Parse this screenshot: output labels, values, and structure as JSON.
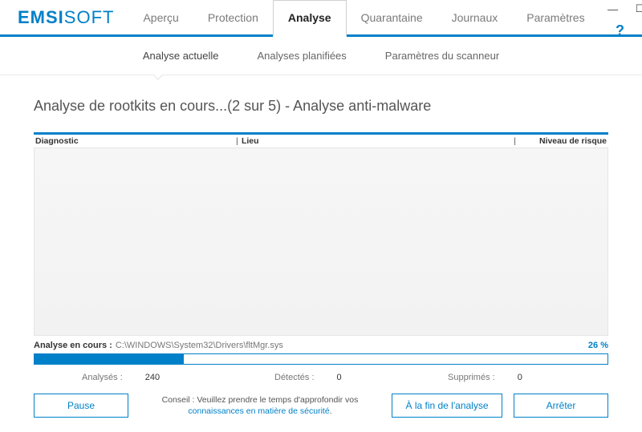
{
  "brand": {
    "bold": "EMSI",
    "light": "SOFT"
  },
  "window_controls": {
    "minimize": "—",
    "maximize": "☐",
    "close": "✕"
  },
  "help_glyph": "?",
  "main_tabs": [
    {
      "label": "Aperçu"
    },
    {
      "label": "Protection"
    },
    {
      "label": "Analyse",
      "active": true
    },
    {
      "label": "Quarantaine"
    },
    {
      "label": "Journaux"
    },
    {
      "label": "Paramètres"
    }
  ],
  "sub_tabs": [
    {
      "label": "Analyse actuelle",
      "active": true
    },
    {
      "label": "Analyses planifiées"
    },
    {
      "label": "Paramètres du scanneur"
    }
  ],
  "page_title": "Analyse de rootkits en cours...(2 sur 5) - Analyse anti-malware",
  "columns": {
    "diagnostic": "Diagnostic",
    "lieu": "Lieu",
    "risque": "Niveau de risque"
  },
  "scan": {
    "label": "Analyse en cours :",
    "path": "C:\\WINDOWS\\System32\\Drivers\\fltMgr.sys",
    "percent_label": "26 %",
    "percent_value": 26
  },
  "stats": {
    "analysed_label": "Analysés :",
    "analysed_value": "240",
    "detected_label": "Détectés :",
    "detected_value": "0",
    "deleted_label": "Supprimés :",
    "deleted_value": "0"
  },
  "footer": {
    "pause": "Pause",
    "tip_prefix": "Conseil : Veuillez prendre le temps d'approfondir vos ",
    "tip_link": "connaissances en matière de sécurité",
    "tip_suffix": ".",
    "at_end": "À la fin de l'analyse",
    "stop": "Arrêter"
  }
}
